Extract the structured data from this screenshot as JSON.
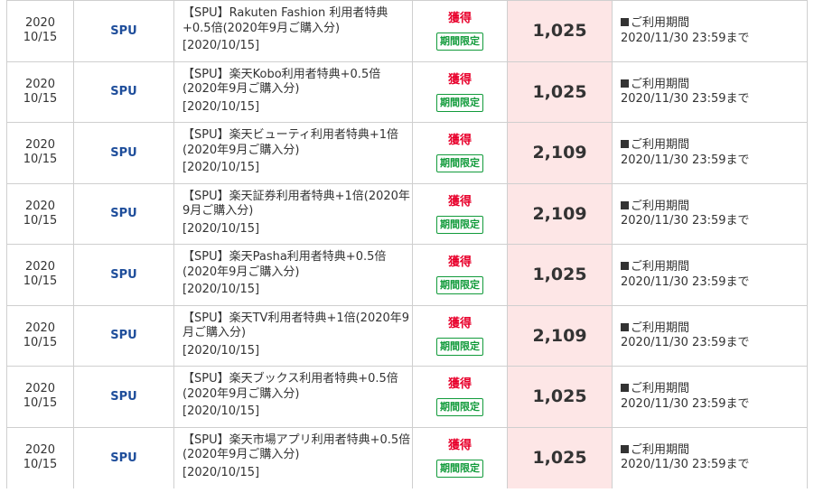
{
  "rows": [
    {
      "year": "2020",
      "md": "10/15",
      "service": "SPU",
      "desc": "【SPU】Rakuten Fashion 利用者特典+0.5倍(2020年9月ご購入分)",
      "date": "[2020/10/15]",
      "action": "獲得",
      "badge": "期間限定",
      "points": "1,025",
      "note_label": "ご利用期間",
      "note_date": "2020/11/30 23:59まで"
    },
    {
      "year": "2020",
      "md": "10/15",
      "service": "SPU",
      "desc": "【SPU】楽天Kobo利用者特典+0.5倍(2020年9月ご購入分)",
      "date": "[2020/10/15]",
      "action": "獲得",
      "badge": "期間限定",
      "points": "1,025",
      "note_label": "ご利用期間",
      "note_date": "2020/11/30 23:59まで"
    },
    {
      "year": "2020",
      "md": "10/15",
      "service": "SPU",
      "desc": "【SPU】楽天ビューティ利用者特典+1倍(2020年9月ご購入分)",
      "date": "[2020/10/15]",
      "action": "獲得",
      "badge": "期間限定",
      "points": "2,109",
      "note_label": "ご利用期間",
      "note_date": "2020/11/30 23:59まで"
    },
    {
      "year": "2020",
      "md": "10/15",
      "service": "SPU",
      "desc": "【SPU】楽天証券利用者特典+1倍(2020年9月ご購入分)",
      "date": "[2020/10/15]",
      "action": "獲得",
      "badge": "期間限定",
      "points": "2,109",
      "note_label": "ご利用期間",
      "note_date": "2020/11/30 23:59まで"
    },
    {
      "year": "2020",
      "md": "10/15",
      "service": "SPU",
      "desc": "【SPU】楽天Pasha利用者特典+0.5倍(2020年9月ご購入分)",
      "date": "[2020/10/15]",
      "action": "獲得",
      "badge": "期間限定",
      "points": "1,025",
      "note_label": "ご利用期間",
      "note_date": "2020/11/30 23:59まで"
    },
    {
      "year": "2020",
      "md": "10/15",
      "service": "SPU",
      "desc": "【SPU】楽天TV利用者特典+1倍(2020年9月ご購入分)",
      "date": "[2020/10/15]",
      "action": "獲得",
      "badge": "期間限定",
      "points": "2,109",
      "note_label": "ご利用期間",
      "note_date": "2020/11/30 23:59まで"
    },
    {
      "year": "2020",
      "md": "10/15",
      "service": "SPU",
      "desc": "【SPU】楽天ブックス利用者特典+0.5倍(2020年9月ご購入分)",
      "date": "[2020/10/15]",
      "action": "獲得",
      "badge": "期間限定",
      "points": "1,025",
      "note_label": "ご利用期間",
      "note_date": "2020/11/30 23:59まで"
    },
    {
      "year": "2020",
      "md": "10/15",
      "service": "SPU",
      "desc": "【SPU】楽天市場アプリ利用者特典+0.5倍(2020年9月ご購入分)",
      "date": "[2020/10/15]",
      "action": "獲得",
      "badge": "期間限定",
      "points": "1,025",
      "note_label": "ご利用期間",
      "note_date": "2020/11/30 23:59まで"
    }
  ],
  "colors": {
    "service": "#1f4e9b",
    "action": "#e8002b",
    "badge": "#129b3b",
    "points_bg": "#fde6e6",
    "border": "#cfcfcf"
  },
  "icons": {
    "note_marker": "black-square-icon"
  }
}
